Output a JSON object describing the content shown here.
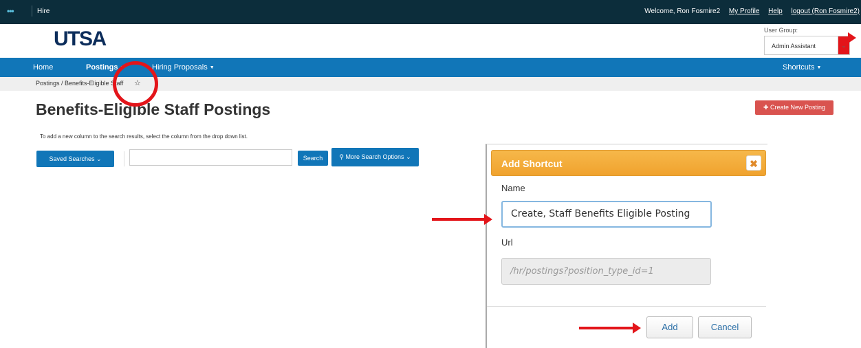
{
  "topbar": {
    "app_name": "Hire",
    "welcome": "Welcome, Ron Fosmire2",
    "my_profile": "My Profile",
    "help": "Help",
    "logout": "logout (Ron Fosmire2)"
  },
  "header": {
    "logo_text": "UTSA",
    "user_group_label": "User Group:",
    "user_group_value": "Admin Assistant"
  },
  "nav": {
    "home": "Home",
    "postings": "Postings",
    "hiring_proposals": "Hiring Proposals",
    "shortcuts": "Shortcuts"
  },
  "breadcrumb": {
    "text": "Postings / Benefits-Eligible Staff"
  },
  "main": {
    "title": "Benefits-Eligible Staff Postings",
    "create_button": "Create New Posting",
    "instructions": "To add a new column to the search results, select the column from the drop down list.",
    "saved_searches": "Saved Searches",
    "search_button": "Search",
    "more_search_options": "More Search Options",
    "search_value": ""
  },
  "dialog": {
    "title": "Add Shortcut",
    "name_label": "Name",
    "name_value": "Create, Staff Benefits Eligible Posting",
    "url_label": "Url",
    "url_value": "/hr/postings?position_type_id=1",
    "add_button": "Add",
    "cancel_button": "Cancel"
  },
  "colors": {
    "topbar": "#0c2d3b",
    "nav": "#1176b8",
    "create_button": "#d9534f",
    "dialog_header": "#f0a22e",
    "annotation": "#e3151a"
  }
}
